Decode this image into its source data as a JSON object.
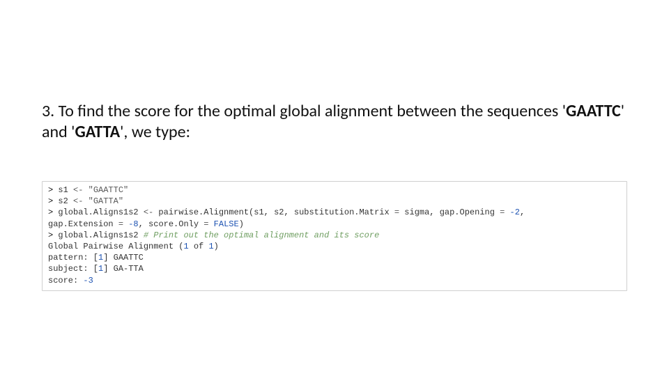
{
  "instruction": {
    "pre": "3. To find the score for the optimal global alignment between the sequences '",
    "seq1": "GAATTC",
    "mid": "' and '",
    "seq2": "GATTA",
    "post": "', we type:"
  },
  "code": {
    "arrow": "<-",
    "s1_assign_left": "s1 ",
    "s1_literal": "\"GAATTC\"",
    "s2_assign_left": "s2 ",
    "s2_literal": "\"GATTA\"",
    "ga_assign_left": "global.Aligns1s2 ",
    "fn_call_part1": " pairwise.Alignment(s1, s2, substitution.Matrix ",
    "fn_call_part2": " sigma, gap.Opening ",
    "fn_call_part3": ",",
    "eq": "=",
    "neg2": "-2",
    "gap_ext_left": "gap.Extension ",
    "neg8": "-8",
    "score_only_left": ", score.Only ",
    "false": "FALSE",
    "close_paren": ")",
    "print_left": "global.Aligns1s2 ",
    "comment": "# Print out the optimal alignment and its score",
    "out1": "Global Pairwise Alignment (",
    "one": "1",
    "out1_mid": " of ",
    "out1_end": ")",
    "out2_left": "pattern: [",
    "out2_right": "] GAATTC",
    "out3_left": "subject: [",
    "out3_right": "] GA-TTA",
    "out4_left": "score: ",
    "neg3": "-3",
    "prompt": "> "
  }
}
